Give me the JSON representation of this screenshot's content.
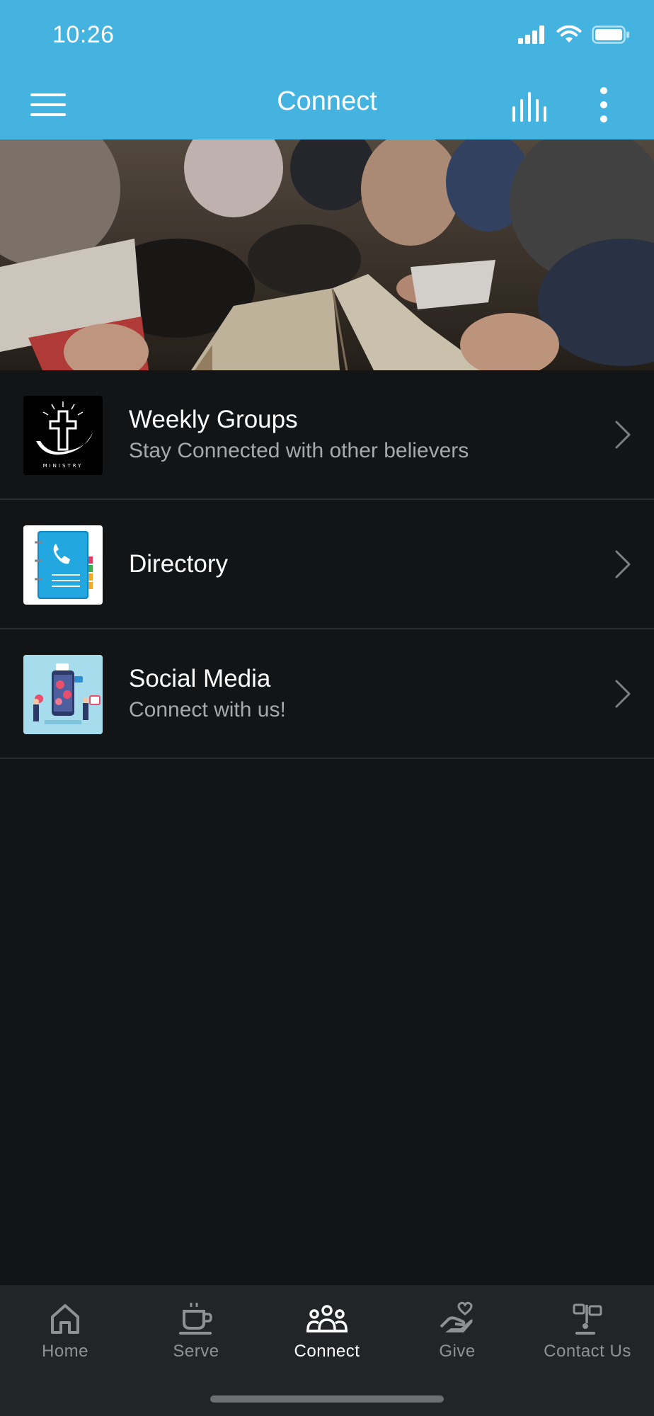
{
  "status_bar": {
    "time": "10:26",
    "icons": [
      "signal-icon",
      "wifi-icon",
      "battery-icon"
    ]
  },
  "header": {
    "title": "Connect",
    "left_icon": "hamburger-menu-icon",
    "right_icons": [
      "audio-bars-icon",
      "more-vertical-icon"
    ],
    "background_color": "#45b3e0"
  },
  "hero": {
    "image": "people-studying-bible-photo"
  },
  "list": {
    "items": [
      {
        "title": "Weekly Groups",
        "subtitle": "Stay Connected with other believers",
        "thumb_icon": "cross-ministry-logo",
        "thumb_text": "MINISTRY"
      },
      {
        "title": "Directory",
        "subtitle": "",
        "thumb_icon": "phone-book-icon"
      },
      {
        "title": "Social Media",
        "subtitle": "Connect with us!",
        "thumb_icon": "social-media-illustration"
      }
    ]
  },
  "tab_bar": {
    "active": "Connect",
    "tabs": [
      {
        "label": "Home",
        "icon": "home-icon"
      },
      {
        "label": "Serve",
        "icon": "coffee-cup-icon"
      },
      {
        "label": "Connect",
        "icon": "people-group-icon"
      },
      {
        "label": "Give",
        "icon": "hand-heart-icon"
      },
      {
        "label": "Contact Us",
        "icon": "signpost-icon"
      }
    ]
  },
  "colors": {
    "accent": "#45b3e0",
    "background": "#131416",
    "tab_bar": "#232427",
    "subtitle": "#a7a9ad"
  }
}
